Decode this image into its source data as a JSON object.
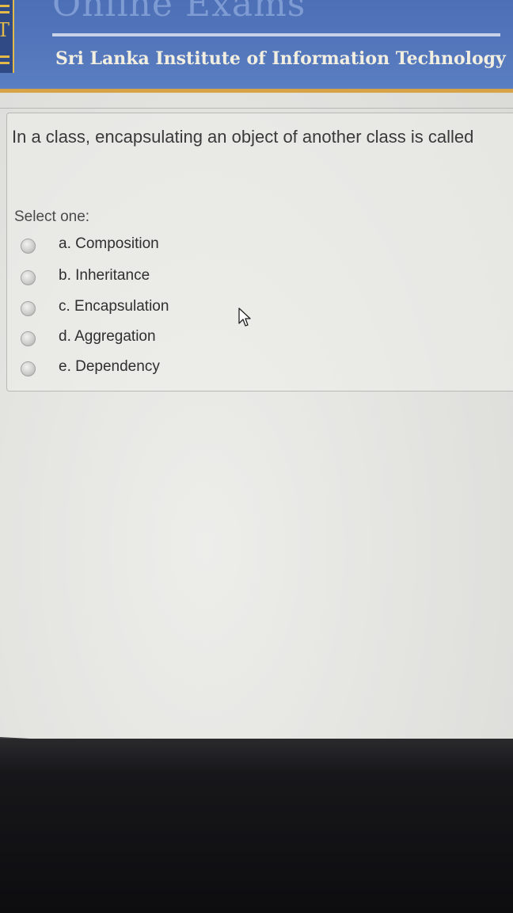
{
  "header": {
    "title": "Online Exams",
    "subtitle": "Sri Lanka Institute of Information Technology"
  },
  "question": {
    "text": "In a class, encapsulating an object of another class is called",
    "prompt": "Select one:",
    "options": [
      {
        "label": "a. Composition",
        "selected": false
      },
      {
        "label": "b. Inheritance",
        "selected": false
      },
      {
        "label": "c. Encapsulation",
        "selected": false
      },
      {
        "label": "d. Aggregation",
        "selected": false
      },
      {
        "label": "e. Dependency",
        "selected": false
      }
    ]
  },
  "icons": {
    "cursor": "mouse-pointer-icon",
    "logo": "institute-logo"
  },
  "colors": {
    "header": "#5a7ec2",
    "accent": "#d7a347"
  }
}
